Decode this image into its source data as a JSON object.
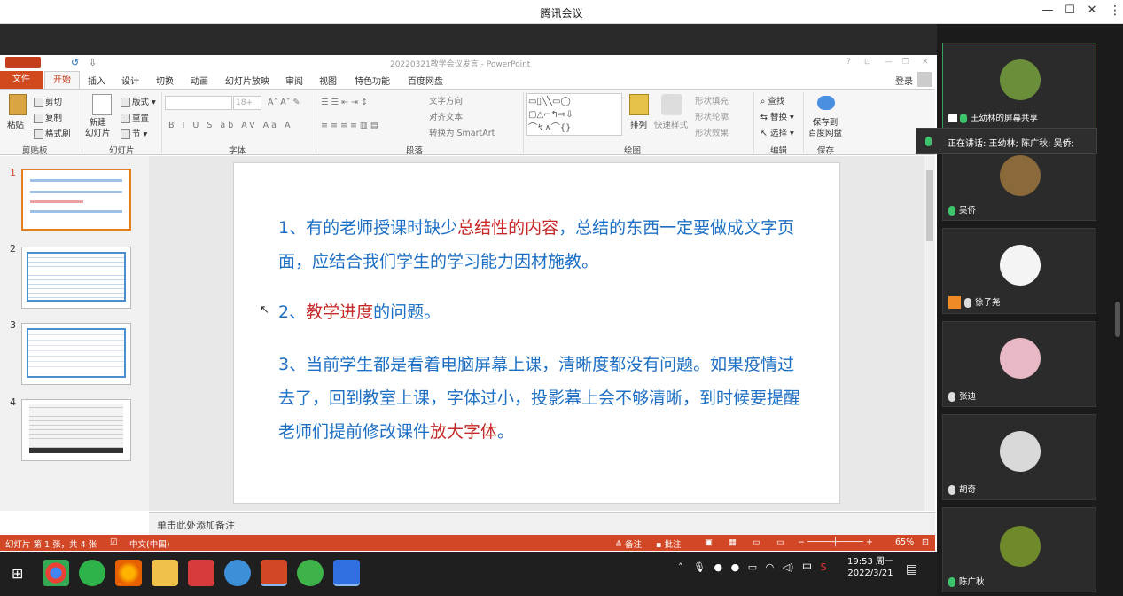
{
  "window": {
    "title": "腾讯会议",
    "minimize": "—",
    "maximize": "☐",
    "close": "✕"
  },
  "ppt": {
    "doc_title": "20220321教学会议发言 - PowerPoint",
    "login": "登录",
    "tabs": [
      "文件",
      "开始",
      "插入",
      "设计",
      "切换",
      "动画",
      "幻灯片放映",
      "审阅",
      "视图",
      "特色功能",
      "百度网盘"
    ],
    "ribbon": {
      "paste": "粘贴",
      "cut": "剪切",
      "copy": "复制",
      "format_painter": "格式刷",
      "new_slide": "新建\n幻灯片",
      "layout": "版式",
      "reset": "重置",
      "section": "节",
      "font_size": "18+",
      "text_direction": "文字方向",
      "align_text": "对齐文本",
      "smartart": "转换为 SmartArt",
      "arrange": "排列",
      "quick_styles": "快速样式",
      "shape_fill": "形状填充",
      "shape_outline": "形状轮廓",
      "shape_effects": "形状效果",
      "find": "查找",
      "replace": "替换",
      "select": "选择",
      "save_to": "保存到\n百度网盘"
    },
    "groups": [
      "剪贴板",
      "幻灯片",
      "字体",
      "段落",
      "绘图",
      "编辑",
      "保存"
    ],
    "thumbnails": [
      "1",
      "2",
      "3",
      "4"
    ],
    "slide": {
      "p1a": "1、有的老师授课时缺少",
      "p1b": "总结性的内容",
      "p1c": "，总结的东西一定要做成文字页面，应结合我们学生的学习能力因材施教。",
      "p2a": "2、",
      "p2b": "教学进度",
      "p2c": "的问题。",
      "p3a": "3、当前学生都是看着电脑屏幕上课，清晰度都没有问题。如果疫情过去了，回到教室上课，字体过小，投影幕上会不够清晰，到时候要提醒老师们提前修改课件",
      "p3b": "放大字体",
      "p3c": "。"
    },
    "notes_placeholder": "单击此处添加备注",
    "status": {
      "slide": "幻灯片 第 1 张，共 4 张",
      "lang": "中文(中国)",
      "notes": "备注",
      "comments": "批注",
      "zoom": "65%"
    }
  },
  "taskbar": {
    "time": "19:53 周一",
    "date": "2022/3/21",
    "ime": "中"
  },
  "meeting": {
    "speaking": "正在讲话: 王幼林; 陈广秋; 吴侨;",
    "participants": [
      {
        "name": "王幼林的屏幕共享",
        "avatar_color": "#6b8e3a"
      },
      {
        "name": "吴侨",
        "avatar_color": "#8a6a3a"
      },
      {
        "name": "徐子尧",
        "avatar_color": "#f4f4f4"
      },
      {
        "name": "张迪",
        "avatar_color": "#e8b8c4"
      },
      {
        "name": "胡奇",
        "avatar_color": "#d9d9d9"
      },
      {
        "name": "陈广秋",
        "avatar_color": "#6f8a2a"
      }
    ]
  }
}
